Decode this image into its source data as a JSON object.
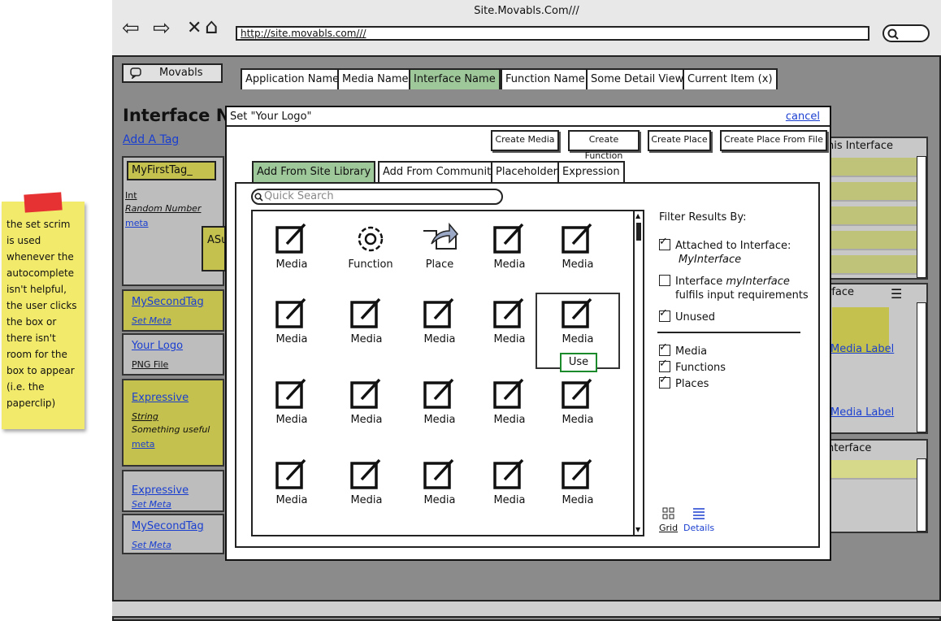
{
  "browser": {
    "title": "Site.Movabls.Com///",
    "url": "http://site.movabls.com///",
    "nav_icons": [
      "back-arrow-icon",
      "forward-arrow-icon",
      "close-icon",
      "home-icon",
      "search-icon"
    ]
  },
  "app": {
    "name": "Movabls",
    "tabs": [
      "Application Name",
      "Media Name",
      "Interface Name",
      "Function Name",
      "Some Detail View",
      "Current Item (x)"
    ],
    "active_tab": "Interface Name"
  },
  "page": {
    "title": "Interface Na",
    "add_tag": "Add A Tag",
    "tag_input": "MyFirstTag_",
    "tag_meta": [
      "Int",
      "Random Number",
      "meta"
    ],
    "side_label": "ASu",
    "cards": [
      {
        "title": "MySecondTag",
        "sub": "Set Meta"
      },
      {
        "title": "Your Logo",
        "sub": "PNG File"
      },
      {
        "title": "Expressive",
        "lines": [
          "String",
          "Something useful",
          "meta"
        ]
      },
      {
        "title": "Expressive",
        "sub": "Set Meta"
      },
      {
        "title": "MySecondTag",
        "sub": "Set Meta"
      }
    ]
  },
  "right_panels": {
    "panel1_title": "his Interface",
    "panel2_title": "rface",
    "media_label_1": "Media Label",
    "media_label_2": "Media Label",
    "panel3_title": "nterface"
  },
  "sticky_note": {
    "text": "the set scrim is used whenever the autocomplete isn't helpful, the user clicks the box or there isn't room for the box to appear (i.e. the paperclip)"
  },
  "modal": {
    "title": "Set \"Your Logo\"",
    "cancel": "cancel",
    "buttons": [
      "Create Media",
      "Create Function",
      "Create Place",
      "Create Place From File"
    ],
    "tabs": [
      "Add From Site Library",
      "Add From Community",
      "Placeholder",
      "Expression"
    ],
    "active_tab": "Add From Site Library",
    "search_placeholder": "Quick Search",
    "grid_items": [
      "Media",
      "Function",
      "Place",
      "Media",
      "Media",
      "Media",
      "Media",
      "Media",
      "Media",
      "Media",
      "Media",
      "Media",
      "Media",
      "Media",
      "Media",
      "Media",
      "Media",
      "Media",
      "Media",
      "Media"
    ],
    "use_button": "Use",
    "filter": {
      "heading": "Filter Results By:",
      "attached_label": "Attached to Interface:",
      "attached_value": "MyInterface",
      "fulfils_pre": "Interface ",
      "fulfils_name": "myInterface",
      "fulfils_post": "fulfils input requirements",
      "unused": "Unused",
      "types": [
        "Media",
        "Functions",
        "Places"
      ],
      "checked": {
        "attached": true,
        "fulfils": false,
        "unused": true,
        "media": true,
        "functions": true,
        "places": true
      }
    },
    "view_modes": [
      "Grid",
      "Details"
    ]
  },
  "colors": {
    "active_tab": "#9fc89a",
    "tag_olive": "#c4c14e",
    "link": "#1a3fd0",
    "sticky": "#f2ea6b",
    "use_border": "#1a8a2a"
  }
}
